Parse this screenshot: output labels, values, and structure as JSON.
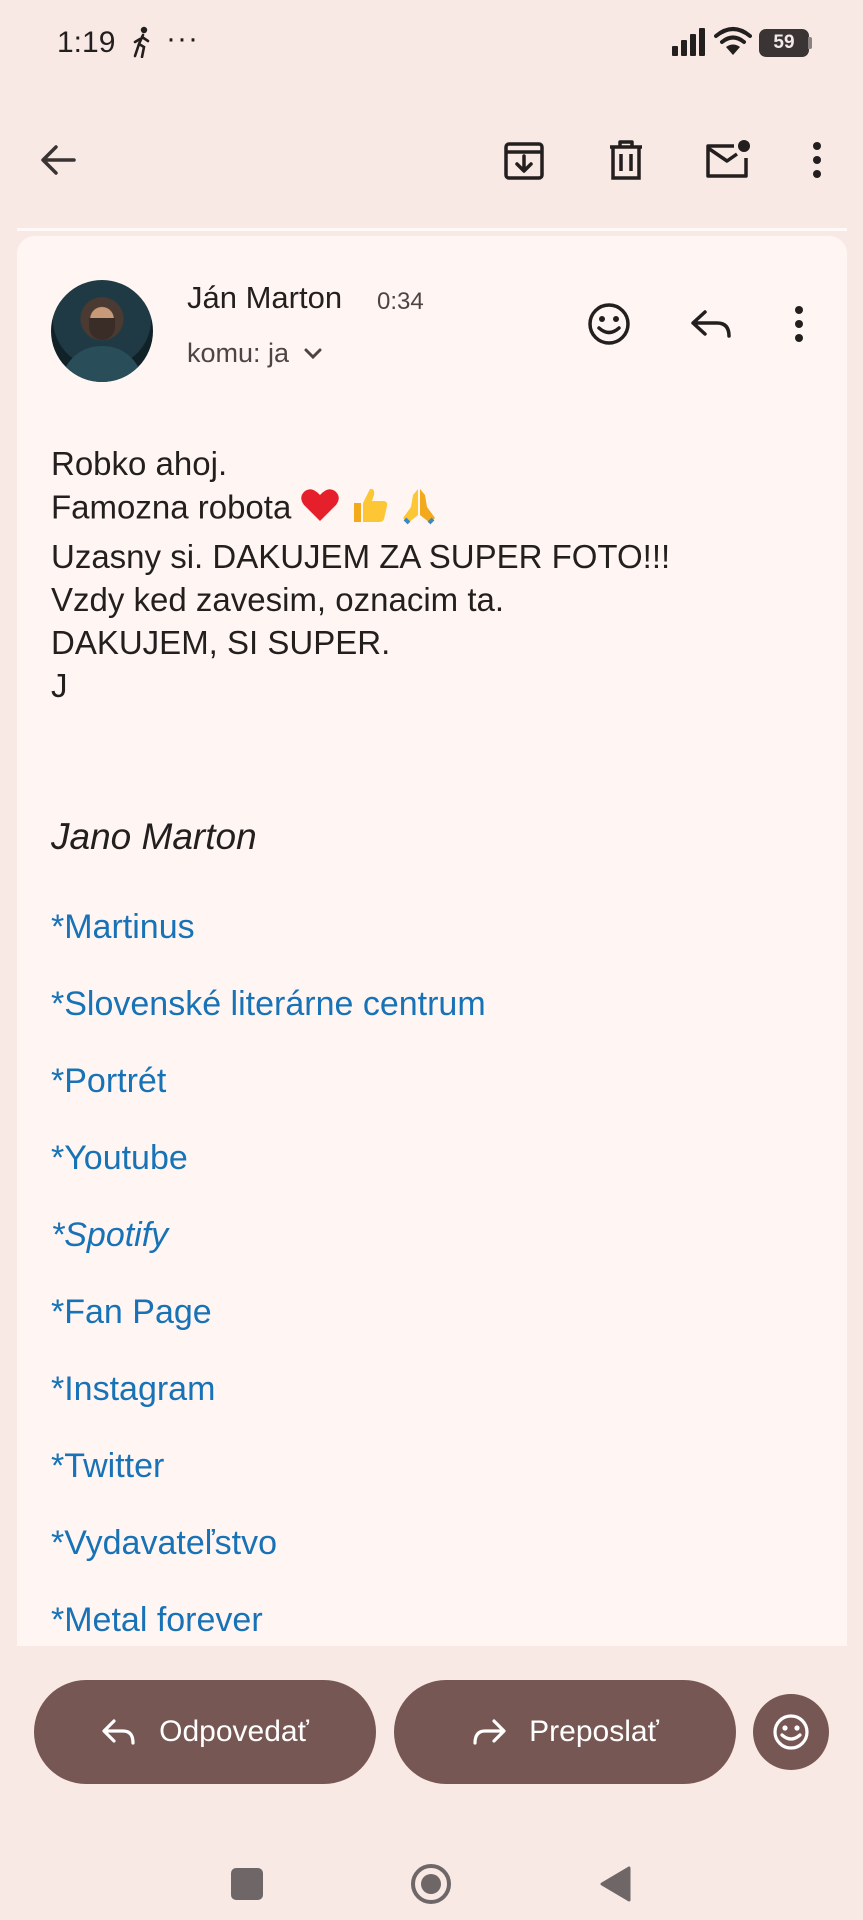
{
  "status_bar": {
    "time": "1:19",
    "more": "···",
    "battery": "59"
  },
  "email": {
    "sender": "Ján Marton",
    "time": "0:34",
    "recipient": "komu: ja",
    "body_lines": [
      "Robko ahoj.",
      "Famozna robota",
      "Uzasny si. DAKUJEM ZA SUPER FOTO!!!",
      "Vzdy ked zavesim, oznacim ta.",
      "DAKUJEM, SI SUPER.",
      "J"
    ],
    "signature_name": "Jano Marton",
    "links": [
      "*Martinus",
      "*Slovenské literárne centrum",
      "*Portrét",
      "*Youtube",
      "*Spotify",
      "*Fan Page",
      "*Instagram",
      "*Twitter",
      "*Vydavateľstvo",
      "*Metal forever"
    ]
  },
  "actions": {
    "reply": "Odpovedať",
    "forward": "Preposlať"
  },
  "colors": {
    "background": "#f9e9e5",
    "card": "#fff6f4",
    "link": "#1872b6",
    "action_button": "#765753"
  }
}
